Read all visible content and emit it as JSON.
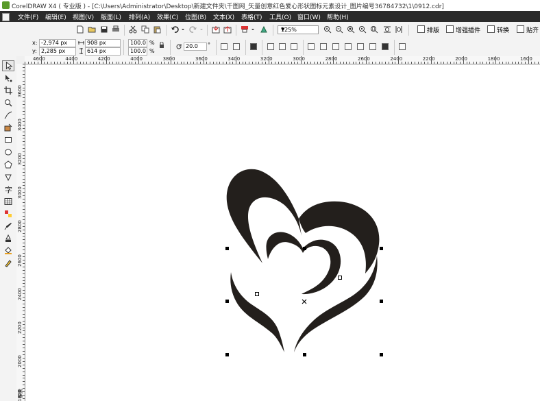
{
  "window": {
    "title": "CorelDRAW X4 ( 专业版 ) - [C:\\Users\\Administrator\\Desktop\\新建文件夹\\千图网_矢量创意红色爱心形状图标元素设计_图片编号36784732\\1\\0912.cdr]"
  },
  "menu": {
    "items": [
      "文件(F)",
      "编辑(E)",
      "视图(V)",
      "版面(L)",
      "排列(A)",
      "效果(C)",
      "位图(B)",
      "文本(X)",
      "表格(T)",
      "工具(O)",
      "窗口(W)",
      "帮助(H)"
    ]
  },
  "toolbar": {
    "zoom": "125%",
    "dock_buttons": [
      "排版",
      "增强插件",
      "转换",
      "贴齐"
    ]
  },
  "propbar": {
    "x_label": "x:",
    "x_value": "-2,974 px",
    "y_label": "y:",
    "y_value": "2,285 px",
    "width_value": "908 px",
    "height_value": "614 px",
    "scale_x": "100.0",
    "scale_y": "100.0",
    "pct1": "%",
    "pct2": "%",
    "rotation": "20.0",
    "degree": "°"
  },
  "rulers": {
    "horizontal": [
      "4600",
      "4400",
      "4200",
      "4000",
      "3800",
      "3600",
      "3400",
      "3200",
      "3000",
      "2800",
      "2600",
      "2400",
      "2200",
      "2000",
      "1800",
      "1600"
    ],
    "vertical": [
      "3600",
      "3400",
      "3200",
      "3000",
      "2800",
      "2600",
      "2400",
      "2200",
      "2000",
      "1800"
    ],
    "unit": "像素"
  },
  "colors": {
    "menubar": "#2b2b2b",
    "toolbar": "#f3f3f3",
    "artwork": "#231f1c",
    "canvas": "#ffffff"
  },
  "icons": {
    "standard": [
      "new-icon",
      "open-icon",
      "save-icon",
      "print-icon",
      "cut-icon",
      "copy-icon",
      "paste-icon",
      "undo-icon",
      "redo-icon",
      "import-icon",
      "export-icon",
      "launcher-icon",
      "welcome-icon",
      "zoom-in-icon",
      "zoom-out-icon",
      "zoom-selected-icon",
      "zoom-all-icon",
      "zoom-page-icon",
      "zoom-width-icon",
      "zoom-height-icon"
    ],
    "tools": [
      "pick-tool-icon",
      "shape-tool-icon",
      "crop-tool-icon",
      "zoom-tool-icon",
      "freehand-tool-icon",
      "smart-fill-icon",
      "rectangle-tool-icon",
      "ellipse-tool-icon",
      "polygon-tool-icon",
      "basic-shapes-icon",
      "text-tool-icon",
      "table-tool-icon",
      "interactive-blend-icon",
      "eyedropper-tool-icon",
      "outline-tool-icon",
      "fill-tool-icon",
      "interactive-fill-icon"
    ]
  }
}
